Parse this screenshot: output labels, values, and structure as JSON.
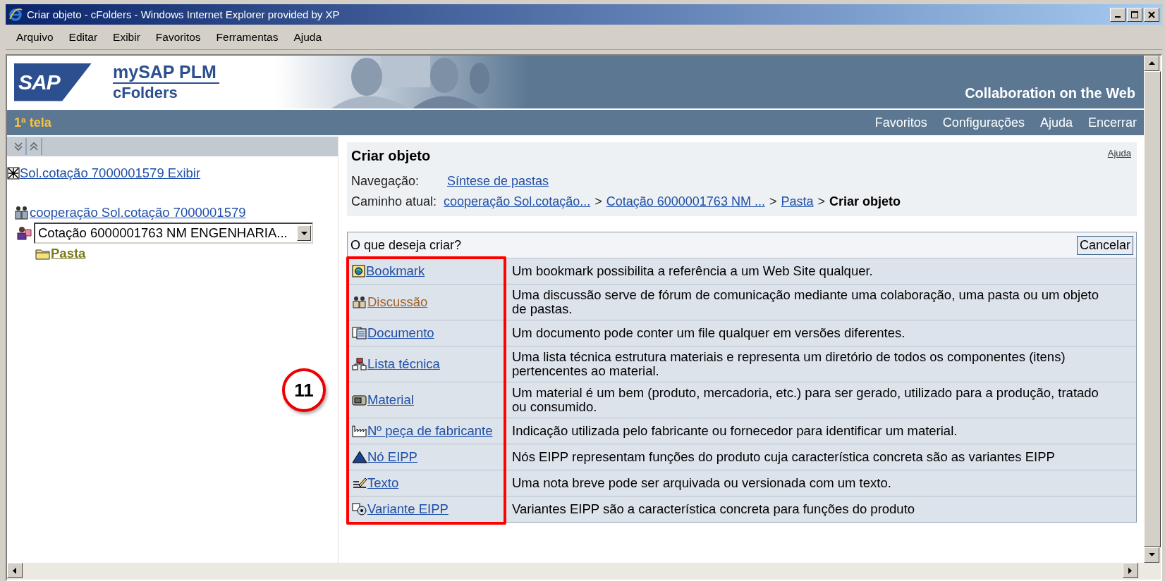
{
  "window": {
    "title": "Criar objeto - cFolders - Windows Internet Explorer provided by XP"
  },
  "menu_bar": [
    "Arquivo",
    "Editar",
    "Exibir",
    "Favoritos",
    "Ferramentas",
    "Ajuda"
  ],
  "header": {
    "logo": "SAP",
    "product": "mySAP PLM",
    "application": "cFolders",
    "tagline": "Collaboration on the Web",
    "page_label": "1ª tela",
    "links": [
      "Favoritos",
      "Configurações",
      "Ajuda",
      "Encerrar"
    ]
  },
  "tree": [
    {
      "kind": "link",
      "label": "Sol.cotação 7000001579 Exibir",
      "children": [
        {
          "kind": "link",
          "label": "cooperação Sol.cotação 7000001579",
          "children": [
            {
              "kind": "dropdown",
              "label": "Cotação 6000001763 NM ENGENHARIA...",
              "children": [
                {
                  "kind": "folder",
                  "label": "Pasta",
                  "selected": true
                }
              ]
            }
          ]
        }
      ]
    }
  ],
  "content": {
    "title": "Criar objeto",
    "help": "Ajuda",
    "navigation_label": "Navegação:",
    "navigation_link": "Síntese de pastas",
    "path_label": "Caminho atual:",
    "path_separator": ">",
    "path": [
      {
        "label": "cooperação Sol.cotação...",
        "link": true
      },
      {
        "label": "Cotação 6000001763 NM ...",
        "link": true
      },
      {
        "label": "Pasta",
        "link": true
      },
      {
        "label": "Criar objeto",
        "link": false
      }
    ]
  },
  "table": {
    "question": "O que deseja criar?",
    "cancel": "Cancelar",
    "rows": [
      {
        "label": "Bookmark",
        "visited": false,
        "description": "Um bookmark possibilita a referência a um Web Site qualquer."
      },
      {
        "label": "Discussão",
        "visited": true,
        "description": "Uma discussão serve de fórum de comunicação mediante uma colaboração, uma pasta ou um objeto de pastas."
      },
      {
        "label": "Documento",
        "visited": false,
        "description": "Um documento pode conter um file qualquer em versões diferentes."
      },
      {
        "label": "Lista técnica",
        "visited": false,
        "description": "Uma lista técnica estrutura materiais e representa um diretório de todos os componentes (itens) pertencentes ao material."
      },
      {
        "label": "Material",
        "visited": false,
        "description": "Um material é um bem (produto, mercadoria, etc.) para ser gerado, utilizado para a produção, tratado ou consumido."
      },
      {
        "label": "Nº peça de fabricante",
        "visited": false,
        "description": "Indicação utilizada pelo fabricante ou fornecedor para identificar um material."
      },
      {
        "label": "Nó EIPP",
        "visited": false,
        "description": "Nós EIPP representam funções do produto cuja característica concreta são as variantes EIPP"
      },
      {
        "label": "Texto",
        "visited": false,
        "description": "Uma nota breve pode ser arquivada ou versionada com um texto."
      },
      {
        "label": "Variante EIPP",
        "visited": false,
        "description": "Variantes EIPP são a característica concreta para funções do produto"
      }
    ]
  },
  "annotation": {
    "number": "11",
    "highlight_first_column": true
  }
}
